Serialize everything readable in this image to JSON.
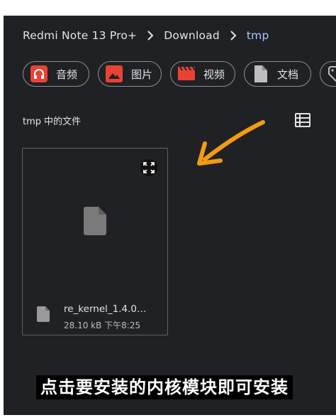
{
  "breadcrumb": {
    "device": "Redmi Note 13 Pro+",
    "folder": "Download",
    "current": "tmp"
  },
  "chips": [
    {
      "label": "音频",
      "icon": "headphones-icon",
      "color": "#e94235"
    },
    {
      "label": "图片",
      "icon": "image-icon",
      "color": "#e94235"
    },
    {
      "label": "视频",
      "icon": "movie-icon",
      "color": "#e94235"
    },
    {
      "label": "文档",
      "icon": "document-icon",
      "color": "#bdbdbd"
    },
    {
      "label": "",
      "icon": "tag-icon",
      "color": "#bdbdbd"
    }
  ],
  "section_title": "tmp 中的文件",
  "file": {
    "name": "re_kernel_1.4.0…",
    "meta": "28.10 kB 下午8:25"
  },
  "caption": "点击要安装的内核模块即可安装",
  "colors": {
    "background": "#202124",
    "accent": "#a8c7fa",
    "arrow": "#f39c12"
  }
}
